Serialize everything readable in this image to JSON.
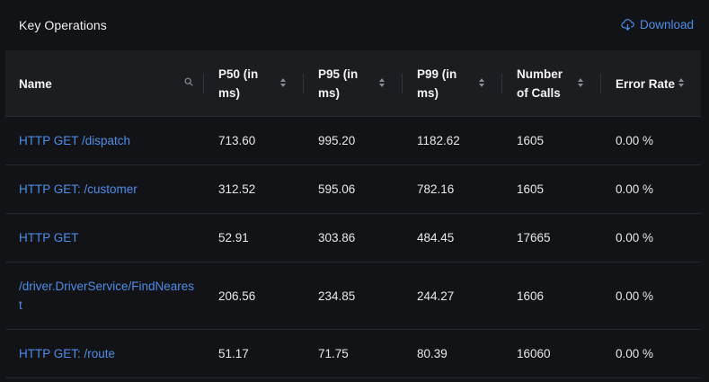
{
  "panel": {
    "title": "Key Operations",
    "download_label": "Download",
    "accent_color": "#4e8de6"
  },
  "columns": [
    {
      "key": "name",
      "label": "Name",
      "control": "search-icon"
    },
    {
      "key": "p50",
      "label": "P50 (in ms)",
      "control": "sort-icon"
    },
    {
      "key": "p95",
      "label": "P95 (in ms)",
      "control": "sort-icon"
    },
    {
      "key": "p99",
      "label": "P99 (in ms)",
      "control": "sort-icon"
    },
    {
      "key": "calls",
      "label": "Number of Calls",
      "control": "sort-icon"
    },
    {
      "key": "error_rate",
      "label": "Error Rate",
      "control": "sort-icon"
    }
  ],
  "rows": [
    {
      "name": "HTTP GET /dispatch",
      "p50": "713.60",
      "p95": "995.20",
      "p99": "1182.62",
      "calls": "1605",
      "error_rate": "0.00 %"
    },
    {
      "name": "HTTP GET: /customer",
      "p50": "312.52",
      "p95": "595.06",
      "p99": "782.16",
      "calls": "1605",
      "error_rate": "0.00 %"
    },
    {
      "name": "HTTP GET",
      "p50": "52.91",
      "p95": "303.86",
      "p99": "484.45",
      "calls": "17665",
      "error_rate": "0.00 %"
    },
    {
      "name": "/driver.DriverService/FindNearest",
      "p50": "206.56",
      "p95": "234.85",
      "p99": "244.27",
      "calls": "1606",
      "error_rate": "0.00 %"
    },
    {
      "name": "HTTP GET: /route",
      "p50": "51.17",
      "p95": "71.75",
      "p99": "80.39",
      "calls": "16060",
      "error_rate": "0.00 %"
    }
  ]
}
